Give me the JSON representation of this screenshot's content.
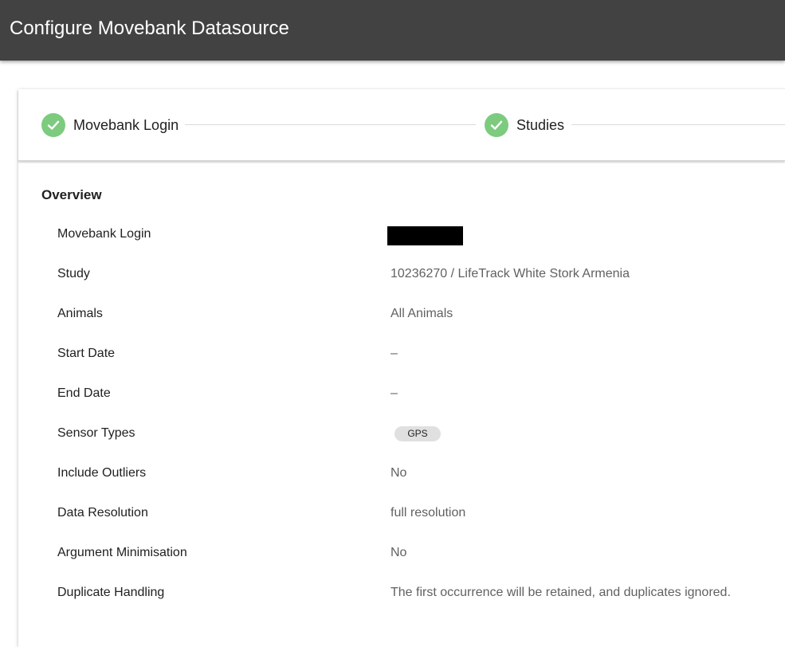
{
  "header": {
    "title": "Configure Movebank Datasource",
    "background_color": "#424242"
  },
  "stepper": {
    "steps": [
      {
        "label": "Movebank Login",
        "status": "completed",
        "icon": "check-icon"
      },
      {
        "label": "Studies",
        "status": "completed",
        "icon": "check-icon"
      }
    ],
    "completed_color": "#7ccb7f"
  },
  "overview": {
    "title": "Overview",
    "rows": [
      {
        "label": "Movebank Login",
        "value": "",
        "redacted": true
      },
      {
        "label": "Study",
        "value": "10236270 / LifeTrack White Stork Armenia"
      },
      {
        "label": "Animals",
        "value": "All Animals"
      },
      {
        "label": "Start Date",
        "value": "–"
      },
      {
        "label": "End Date",
        "value": "–"
      },
      {
        "label": "Sensor Types",
        "value": "GPS",
        "chip": true
      },
      {
        "label": "Include Outliers",
        "value": "No"
      },
      {
        "label": "Data Resolution",
        "value": "full resolution"
      },
      {
        "label": "Argument Minimisation",
        "value": "No"
      },
      {
        "label": "Duplicate Handling",
        "value": "The first occurrence will be retained, and duplicates ignored."
      }
    ]
  }
}
